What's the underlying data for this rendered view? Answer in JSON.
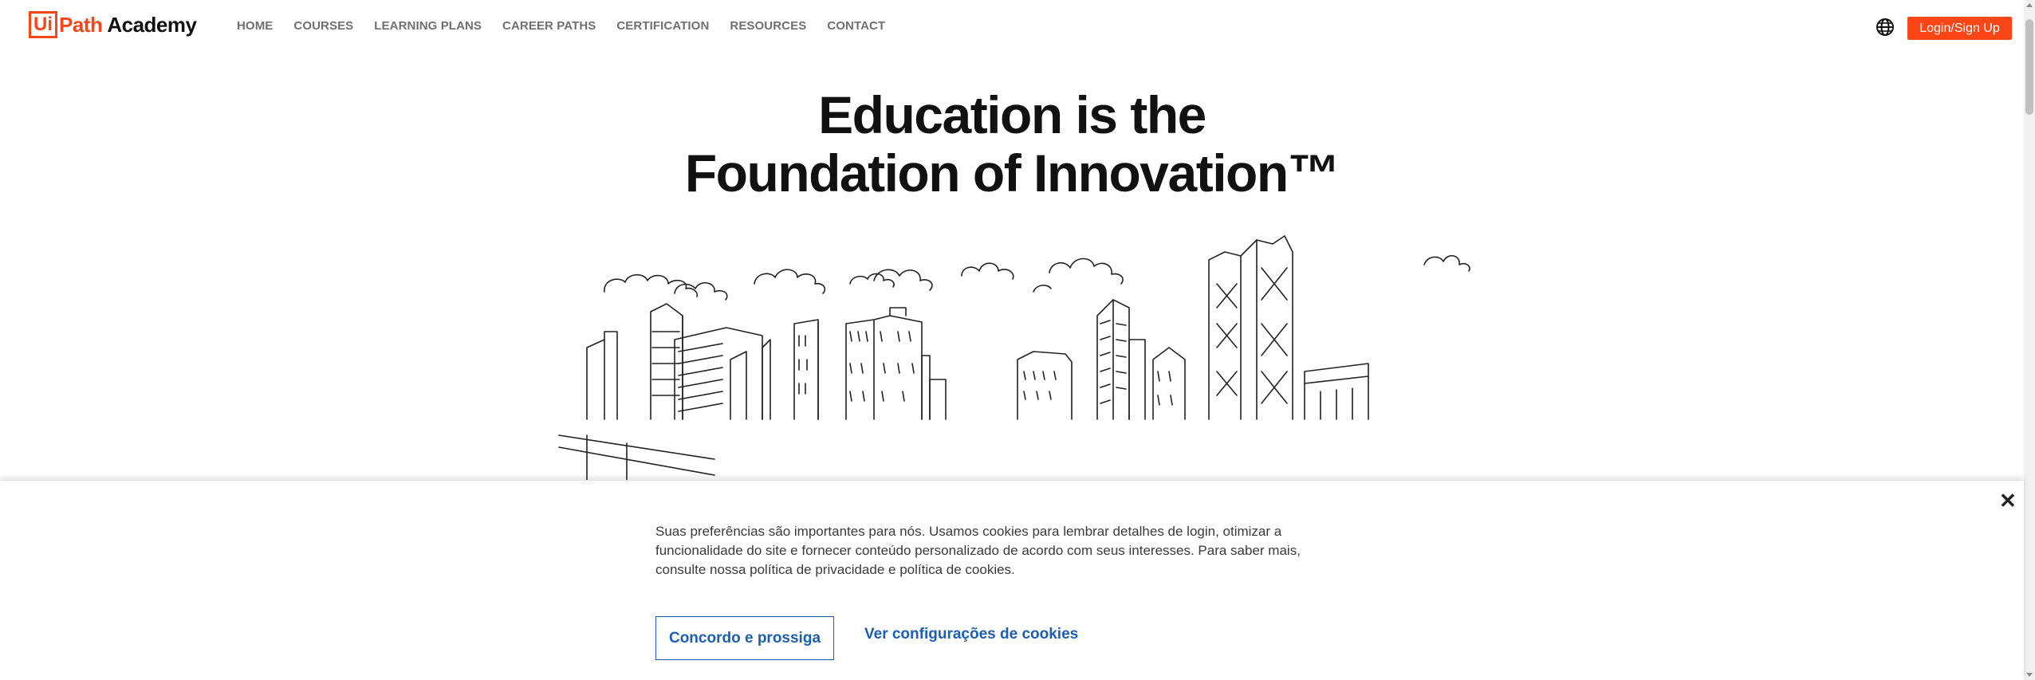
{
  "header": {
    "logo": {
      "mark": "Ui",
      "path": "Path",
      "academy": "Academy"
    },
    "nav": [
      "HOME",
      "COURSES",
      "LEARNING PLANS",
      "CAREER PATHS",
      "CERTIFICATION",
      "RESOURCES",
      "CONTACT"
    ],
    "language_icon": "globe-icon",
    "login_label": "Login/Sign Up"
  },
  "hero": {
    "title_line1": "Education is the",
    "title_line2": "Foundation of Innovation™",
    "illustration": "city-skyline-line-drawing"
  },
  "cookie_banner": {
    "text": "Suas preferências são importantes para nós. Usamos cookies para lembrar detalhes de login, otimizar a funcionalidade do site e fornecer conteúdo personalizado de acordo com seus interesses. Para saber mais, consulte nossa política de privacidade e política de cookies.",
    "accept_label": "Concordo e prossiga",
    "settings_label": "Ver configurações de cookies",
    "close_icon": "close-icon"
  },
  "colors": {
    "brand_orange": "#fa4616",
    "link_blue": "#1a5fb4",
    "nav_gray": "#6f6f6f"
  }
}
